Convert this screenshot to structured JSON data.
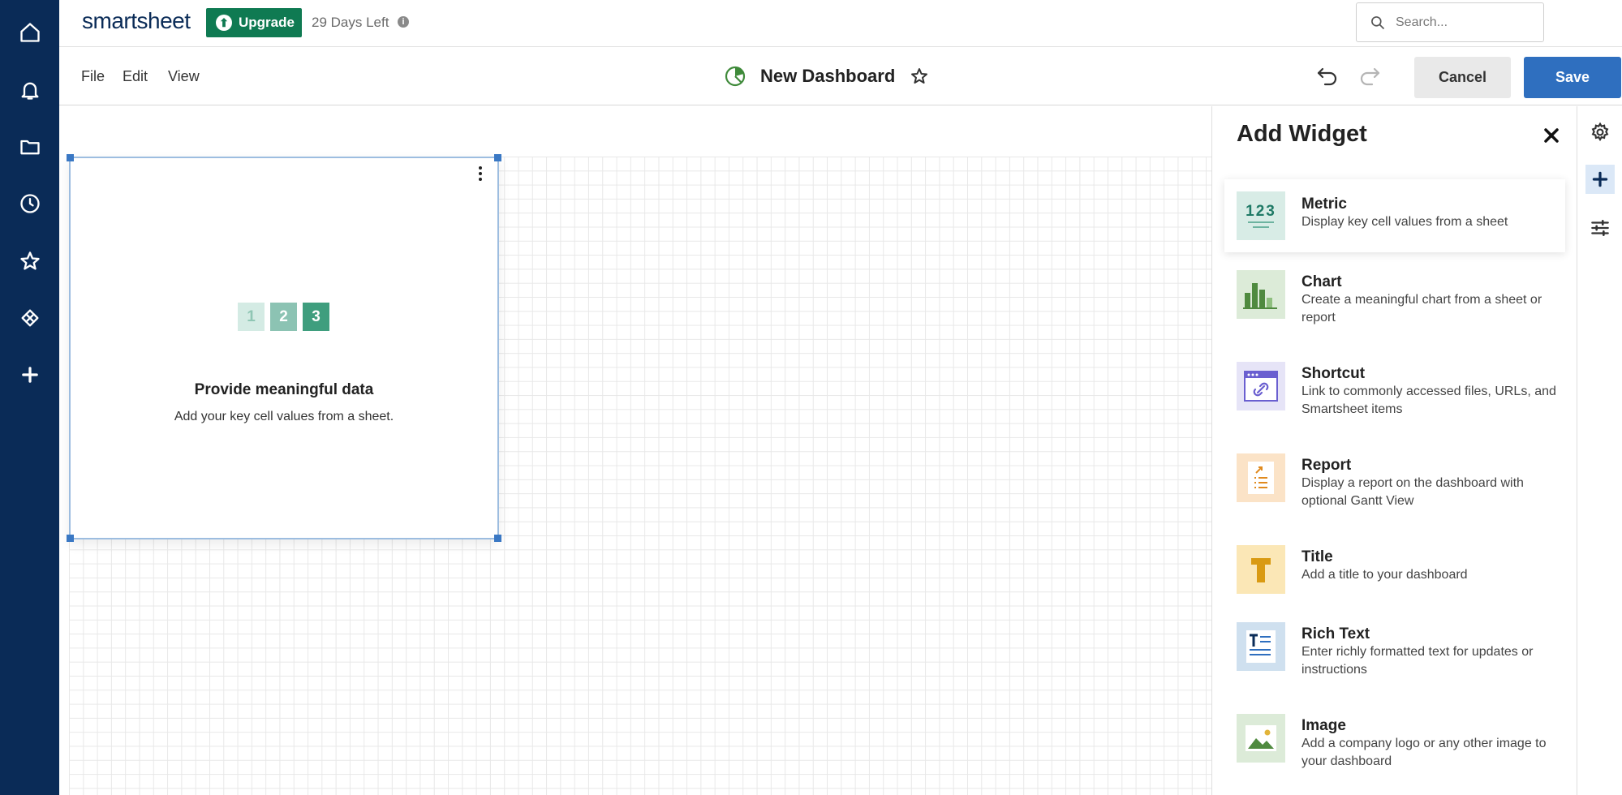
{
  "app": {
    "logo_text": "smartsheet",
    "upgrade_label": "Upgrade",
    "trial_text": "29 Days Left",
    "search_placeholder": "Search..."
  },
  "leftnav": {
    "items": [
      "home-icon",
      "bell-icon",
      "folder-icon",
      "clock-icon",
      "star-icon",
      "solutions-icon",
      "plus-icon"
    ]
  },
  "toolbar": {
    "menus": [
      "File",
      "Edit",
      "View"
    ],
    "dashboard_title": "New Dashboard",
    "cancel_label": "Cancel",
    "save_label": "Save"
  },
  "widget": {
    "numbers": [
      "1",
      "2",
      "3"
    ],
    "title": "Provide meaningful data",
    "subtitle": "Add your key cell values from a sheet."
  },
  "panel": {
    "title": "Add Widget",
    "items": [
      {
        "name": "Metric",
        "desc": "Display key cell values from a sheet",
        "icon": "metric-icon"
      },
      {
        "name": "Chart",
        "desc": "Create a meaningful chart from a sheet or report",
        "icon": "chart-icon"
      },
      {
        "name": "Shortcut",
        "desc": "Link to commonly accessed files, URLs, and Smartsheet items",
        "icon": "shortcut-icon"
      },
      {
        "name": "Report",
        "desc": "Display a report on the dashboard with optional Gantt View",
        "icon": "report-icon"
      },
      {
        "name": "Title",
        "desc": "Add a title to your dashboard",
        "icon": "title-icon"
      },
      {
        "name": "Rich Text",
        "desc": "Enter richly formatted text for updates or instructions",
        "icon": "rich-text-icon"
      },
      {
        "name": "Image",
        "desc": "Add a company logo or any other image to your dashboard",
        "icon": "image-icon"
      }
    ]
  },
  "colors": {
    "nav": "#0a2b57",
    "upgrade": "#0f7a52",
    "save": "#2f6fbf",
    "widget_border": "#9dbde0"
  }
}
